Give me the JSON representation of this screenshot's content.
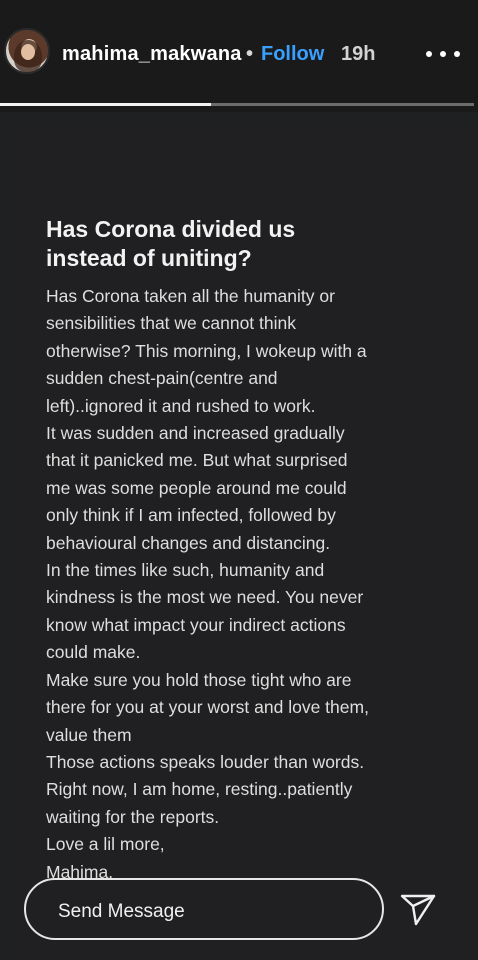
{
  "header": {
    "username": "mahima_makwana",
    "separator": "•",
    "follow_label": "Follow",
    "time": "19h",
    "progress": 0.445,
    "avatar_icon": "profile-avatar-icon",
    "more_icon": "more-horizontal-icon"
  },
  "story": {
    "title": "Has Corona divided us\ninstead of uniting?",
    "body": "Has Corona taken all the humanity or\nsensibilities that we cannot think\notherwise? This morning, I wokeup with a\nsudden chest-pain(centre and\nleft)..ignored it and rushed to work.\nIt was sudden and increased gradually\nthat it panicked me. But what surprised\nme was some people around me could\nonly think if I am infected, followed by\nbehavioural changes and distancing.\nIn the times like such, humanity and\nkindness is the most we need. You never\nknow what impact your indirect actions\ncould make.\nMake sure you hold those tight who are\nthere for you at your worst and love them,\nvalue them\nThose actions speaks louder than words.\nRight now, I am home, resting..patiently\nwaiting for the reports.\nLove a lil more,\nMahima."
  },
  "footer": {
    "message_placeholder": "Send Message",
    "send_icon": "send-icon"
  },
  "colors": {
    "background": "#1f2021",
    "accent": "#3aa0ff",
    "text": "#f2f2f2"
  }
}
